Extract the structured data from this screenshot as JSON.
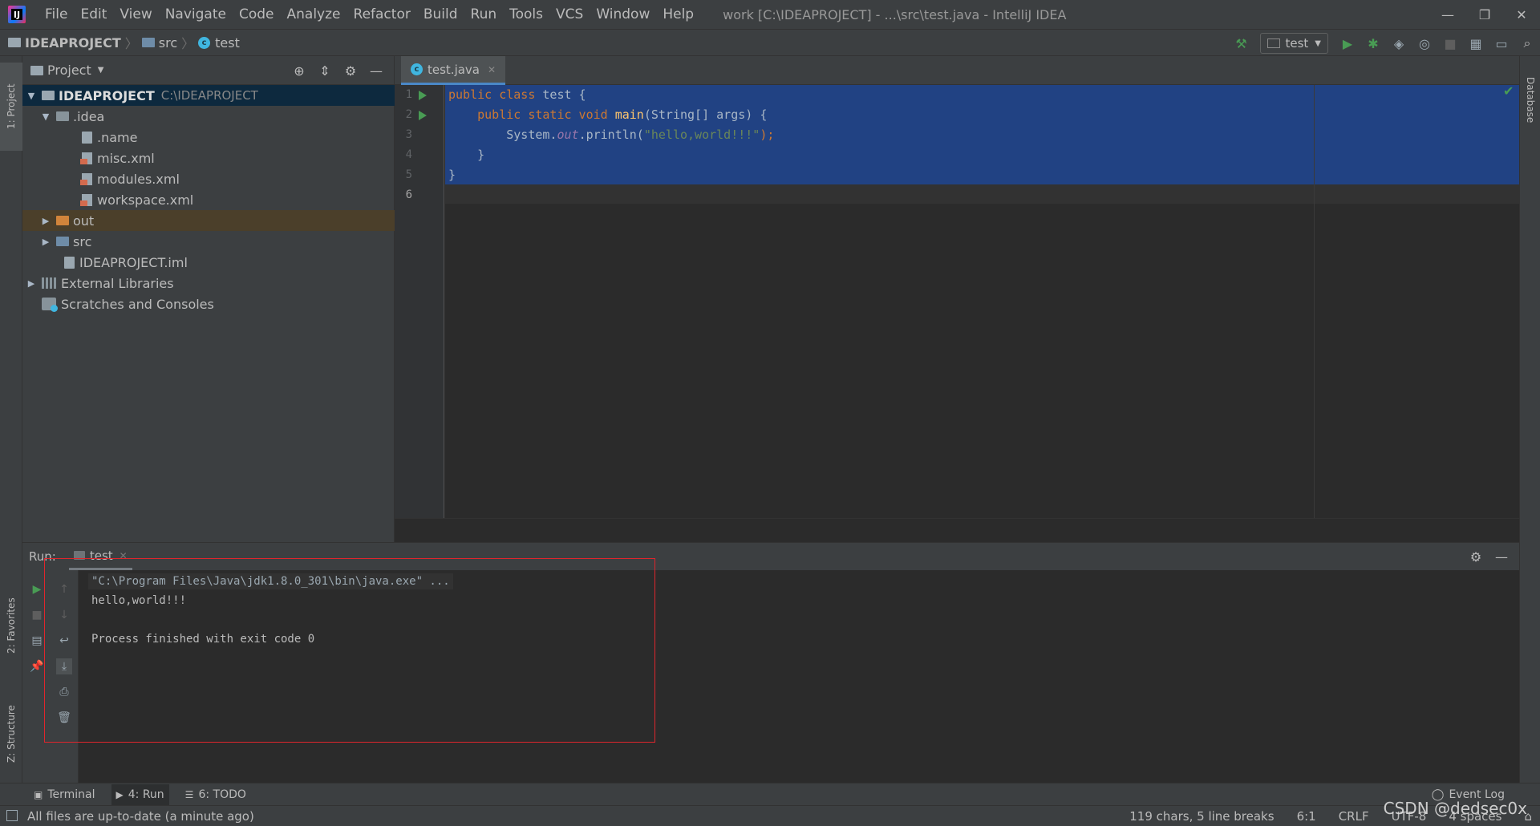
{
  "menubar": {
    "items": [
      "File",
      "Edit",
      "View",
      "Navigate",
      "Code",
      "Analyze",
      "Refactor",
      "Build",
      "Run",
      "Tools",
      "VCS",
      "Window",
      "Help"
    ],
    "window_title": "work [C:\\IDEAPROJECT] - ...\\src\\test.java - IntelliJ IDEA"
  },
  "navbar": {
    "crumbs": [
      "IDEAPROJECT",
      "src",
      "test"
    ],
    "run_config": "test"
  },
  "left_strip": {
    "project_tab": "1: Project",
    "favorites_tab": "2: Favorites",
    "structure_tab": "Z: Structure"
  },
  "right_strip": {
    "database_tab": "Database"
  },
  "project_panel": {
    "title": "Project",
    "tree": [
      {
        "label": "IDEAPROJECT",
        "hint": "C:\\IDEAPROJECT"
      },
      {
        "label": ".idea"
      },
      {
        "label": ".name"
      },
      {
        "label": "misc.xml"
      },
      {
        "label": "modules.xml"
      },
      {
        "label": "workspace.xml"
      },
      {
        "label": "out"
      },
      {
        "label": "src"
      },
      {
        "label": "IDEAPROJECT.iml"
      },
      {
        "label": "External Libraries"
      },
      {
        "label": "Scratches and Consoles"
      }
    ]
  },
  "editor": {
    "tab": "test.java",
    "line_numbers": [
      "1",
      "2",
      "3",
      "4",
      "5",
      "6"
    ],
    "code": {
      "l1_kw": "public class ",
      "l1_rest": "test {",
      "l2_kw": "    public static void ",
      "l2_fn": "main",
      "l2_rest": "(String[] args) {",
      "l3_pre": "        System.",
      "l3_it": "out",
      "l3_mid": ".println(",
      "l3_str": "\"hello,world!!!\"",
      "l3_end": ");",
      "l4": "    }",
      "l5": "}"
    }
  },
  "run_panel": {
    "label": "Run:",
    "tab": "test",
    "console": {
      "cmd": "\"C:\\Program Files\\Java\\jdk1.8.0_301\\bin\\java.exe\" ...",
      "output": "hello,world!!!",
      "exit": "Process finished with exit code 0"
    }
  },
  "bottom_tabs": {
    "terminal": "Terminal",
    "run": "4: Run",
    "todo": "6: TODO",
    "event_log": "Event Log"
  },
  "statusbar": {
    "message": "All files are up-to-date (a minute ago)",
    "chars": "119 chars, 5 line breaks",
    "position": "6:1",
    "line_sep": "CRLF",
    "encoding": "UTF-8",
    "indent": "4 spaces"
  },
  "watermark": "CSDN @dedsec0x",
  "colors": {
    "selection": "#214283",
    "keyword": "#cc7832",
    "string": "#6a8759",
    "highlight_frame": "#e0252c"
  }
}
